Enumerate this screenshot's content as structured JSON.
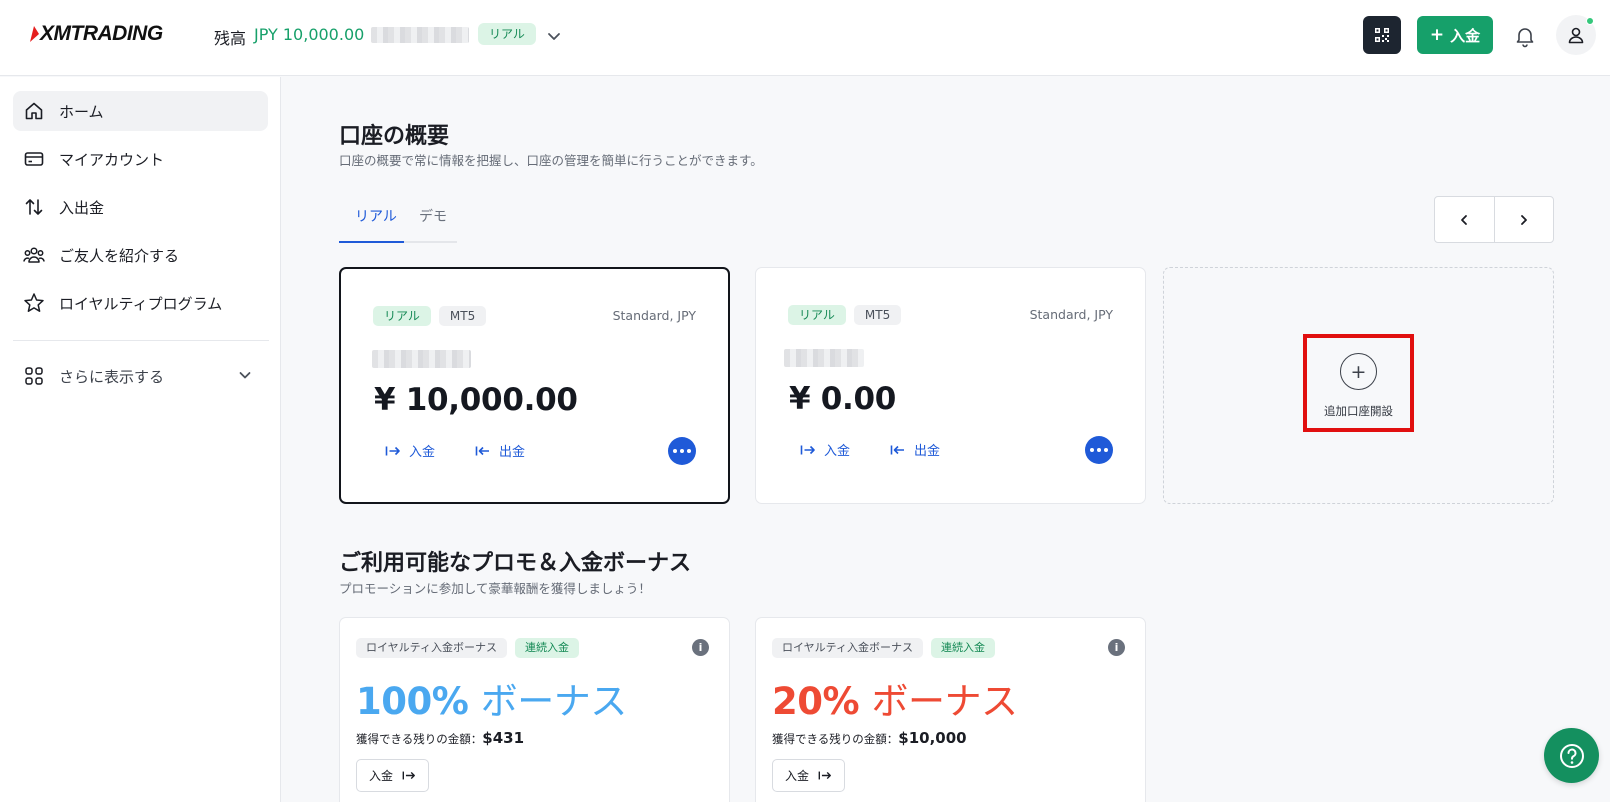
{
  "header": {
    "logo_text": "XMTRADING",
    "balance_label": "残高",
    "balance_value": "JPY 10,000.00",
    "account_badge": "リアル",
    "deposit_button": "入金"
  },
  "sidebar": {
    "items": [
      {
        "label": "ホーム",
        "icon": "home-icon"
      },
      {
        "label": "マイアカウント",
        "icon": "card-icon"
      },
      {
        "label": "入出金",
        "icon": "transfer-arrows-icon"
      },
      {
        "label": "ご友人を紹介する",
        "icon": "people-icon"
      },
      {
        "label": "ロイヤルティプログラム",
        "icon": "star-icon"
      }
    ],
    "more_label": "さらに表示する"
  },
  "overview": {
    "title": "口座の概要",
    "subtitle": "口座の概要で常に情報を把握し、口座の管理を簡単に行うことができます。",
    "tabs": [
      "リアル",
      "デモ"
    ],
    "active_tab": "リアル"
  },
  "accounts": [
    {
      "badge_type": "リアル",
      "badge_platform": "MT5",
      "account_type": "Standard, JPY",
      "amount": "¥ 10,000.00",
      "deposit": "入金",
      "withdraw": "出金",
      "selected": true
    },
    {
      "badge_type": "リアル",
      "badge_platform": "MT5",
      "account_type": "Standard, JPY",
      "amount": "¥ 0.00",
      "deposit": "入金",
      "withdraw": "出金",
      "selected": false
    }
  ],
  "add_account": {
    "label": "追加口座開設"
  },
  "promos": {
    "title": "ご利用可能なプロモ＆入金ボーナス",
    "subtitle": "プロモーションに参加して豪華報酬を獲得しましょう！",
    "cards": [
      {
        "tag_program": "ロイヤルティ入金ボーナス",
        "tag_type": "連続入金",
        "percent": "100%",
        "suffix": "ボーナス",
        "color": "#4aa8f0",
        "remaining_label": "獲得できる残りの金額：",
        "remaining_value": "$431",
        "button": "入金"
      },
      {
        "tag_program": "ロイヤルティ入金ボーナス",
        "tag_type": "連続入金",
        "percent": "20%",
        "suffix": "ボーナス",
        "color": "#ee4a34",
        "remaining_label": "獲得できる残りの金額：",
        "remaining_value": "$10,000",
        "button": "入金"
      }
    ]
  },
  "colors": {
    "brand_green": "#16a06a",
    "link_blue": "#1f5ad8",
    "highlight_red": "#e10f0f"
  }
}
